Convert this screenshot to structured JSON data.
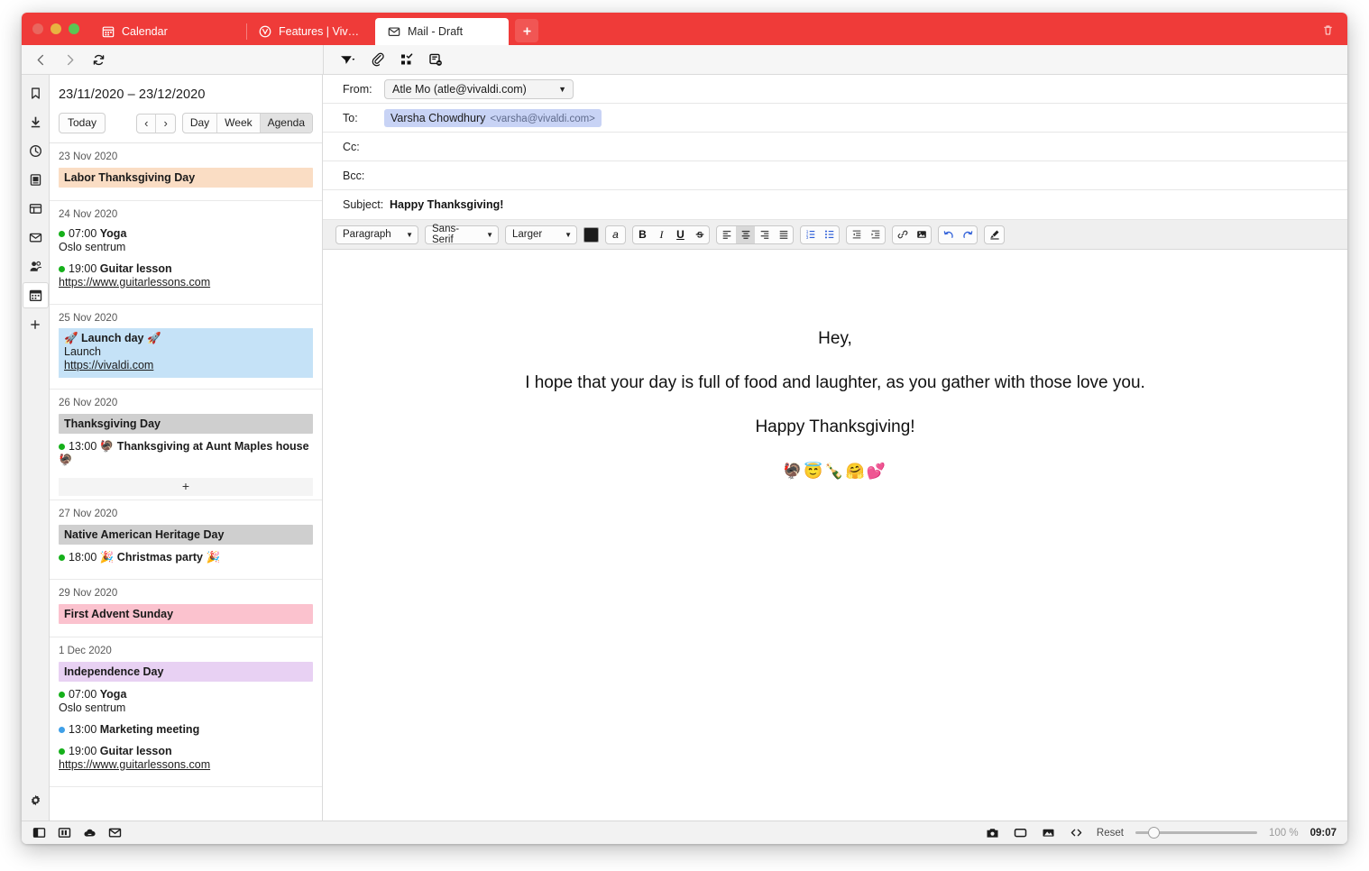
{
  "window": {
    "traffic_lights": [
      "close",
      "minimize",
      "maximize"
    ],
    "accent_color": "#EF3B39"
  },
  "tabbar": {
    "tabs": [
      {
        "label": "Calendar",
        "icon": "calendar-icon",
        "active": false
      },
      {
        "label": "Features | Vivaldi Browser",
        "icon": "vivaldi-shield-icon",
        "active": false
      },
      {
        "label": "Mail - Draft",
        "icon": "mail-icon",
        "active": true
      }
    ],
    "new_tab_label": "+",
    "trash_icon": "trash-icon"
  },
  "navbar": {
    "back_icon": "chevron-left-icon",
    "forward_icon": "chevron-right-icon",
    "reload_icon": "reload-icon",
    "mail_actions": [
      {
        "name": "send-button",
        "icon": "send-icon"
      },
      {
        "name": "attach-button",
        "icon": "paperclip-icon"
      },
      {
        "name": "spellcheck-button",
        "icon": "checkbox-grid-icon"
      },
      {
        "name": "discard-draft-button",
        "icon": "note-minus-icon"
      }
    ]
  },
  "panelstrip": {
    "items": [
      {
        "name": "panel-bookmarks",
        "icon": "bookmark-icon",
        "active": false
      },
      {
        "name": "panel-downloads",
        "icon": "download-icon",
        "active": false
      },
      {
        "name": "panel-history",
        "icon": "clock-icon",
        "active": false
      },
      {
        "name": "panel-notes",
        "icon": "notes-icon",
        "active": false
      },
      {
        "name": "panel-window",
        "icon": "window-icon",
        "active": false
      },
      {
        "name": "panel-mail",
        "icon": "envelope-icon",
        "active": false
      },
      {
        "name": "panel-contacts",
        "icon": "contacts-icon",
        "active": false
      },
      {
        "name": "panel-calendar",
        "icon": "calendar-icon",
        "active": true
      },
      {
        "name": "panel-add",
        "icon": "plus-icon",
        "active": false
      }
    ],
    "settings": {
      "name": "panel-settings",
      "icon": "gear-icon"
    }
  },
  "agenda": {
    "date_range": "23/11/2020 – 23/12/2020",
    "today_label": "Today",
    "prev_label": "‹",
    "next_label": "›",
    "views": [
      {
        "label": "Day",
        "active": false
      },
      {
        "label": "Week",
        "active": false
      },
      {
        "label": "Agenda",
        "active": true
      }
    ],
    "days": [
      {
        "date": "23 Nov 2020",
        "chips": [
          {
            "label": "Labor Thanksgiving Day",
            "color": "#FADDC4"
          }
        ],
        "events": [],
        "add_row": false
      },
      {
        "date": "24 Nov 2020",
        "chips": [],
        "events": [
          {
            "dot": "#15B01A",
            "time": "07:00",
            "title": "Yoga",
            "sub": "Oslo sentrum",
            "link": ""
          },
          {
            "dot": "#15B01A",
            "time": "19:00",
            "title": "Guitar lesson",
            "sub": "",
            "link": "https://www.guitarlessons.com"
          }
        ],
        "add_row": false
      },
      {
        "date": "25 Nov 2020",
        "chips": [],
        "events": [
          {
            "dot": "",
            "time": "",
            "title": "🚀 Launch day 🚀",
            "sub": "Launch",
            "link": "https://vivaldi.com",
            "highlight": "#C5E2F7"
          }
        ],
        "add_row": false
      },
      {
        "date": "26 Nov 2020",
        "chips": [
          {
            "label": "Thanksgiving Day",
            "color": "#CFCFCF"
          }
        ],
        "events": [
          {
            "dot": "#15B01A",
            "time": "13:00",
            "title": "🦃 Thanksgiving at Aunt Maples house 🦃",
            "sub": "",
            "link": ""
          }
        ],
        "add_row": true,
        "add_label": "+"
      },
      {
        "date": "27 Nov 2020",
        "chips": [
          {
            "label": "Native American Heritage Day",
            "color": "#CFCFCF"
          }
        ],
        "events": [
          {
            "dot": "#15B01A",
            "time": "18:00",
            "title": "🎉 Christmas party 🎉",
            "sub": "",
            "link": ""
          }
        ],
        "add_row": false
      },
      {
        "date": "29 Nov 2020",
        "chips": [
          {
            "label": "First Advent Sunday",
            "color": "#FBC2CE"
          }
        ],
        "events": [],
        "add_row": false
      },
      {
        "date": "1 Dec 2020",
        "chips": [
          {
            "label": "Independence Day",
            "color": "#E8D1F3"
          }
        ],
        "events": [
          {
            "dot": "#15B01A",
            "time": "07:00",
            "title": "Yoga",
            "sub": "Oslo sentrum",
            "link": ""
          },
          {
            "dot": "#3FA0E8",
            "time": "13:00",
            "title": "Marketing meeting",
            "sub": "",
            "link": ""
          },
          {
            "dot": "#15B01A",
            "time": "19:00",
            "title": "Guitar lesson",
            "sub": "",
            "link": "https://www.guitarlessons.com"
          }
        ],
        "add_row": false
      }
    ]
  },
  "compose": {
    "from_label": "From:",
    "from_value": "Atle Mo (atle@vivaldi.com)",
    "to_label": "To:",
    "to_name": "Varsha Chowdhury",
    "to_address": "<varsha@vivaldi.com>",
    "cc_label": "Cc:",
    "cc_value": "",
    "bcc_label": "Bcc:",
    "bcc_value": "",
    "subject_label": "Subject:",
    "subject_value": "Happy Thanksgiving!",
    "toolbar": {
      "block_format": "Paragraph",
      "font_family": "Sans-Serif",
      "font_size": "Larger",
      "text_color": "#1b1b1b",
      "highlight_label": "a",
      "buttons": [
        {
          "name": "bold-button",
          "glyph": "B",
          "active": false
        },
        {
          "name": "italic-button",
          "glyph": "I",
          "active": false
        },
        {
          "name": "underline-button",
          "glyph": "U",
          "active": false
        },
        {
          "name": "strikethrough-button",
          "glyph": "S",
          "active": false
        },
        {
          "name": "align-left-button",
          "glyph": "align-left-icon",
          "active": false
        },
        {
          "name": "align-center-button",
          "glyph": "align-center-icon",
          "active": true
        },
        {
          "name": "align-right-button",
          "glyph": "align-right-icon",
          "active": false
        },
        {
          "name": "align-justify-button",
          "glyph": "align-justify-icon",
          "active": false
        },
        {
          "name": "ordered-list-button",
          "glyph": "ordered-list-icon",
          "active": false
        },
        {
          "name": "unordered-list-button",
          "glyph": "unordered-list-icon",
          "active": false
        },
        {
          "name": "outdent-button",
          "glyph": "outdent-icon",
          "active": false
        },
        {
          "name": "indent-button",
          "glyph": "indent-icon",
          "active": false
        },
        {
          "name": "link-button",
          "glyph": "link-icon",
          "active": false
        },
        {
          "name": "image-button",
          "glyph": "image-icon",
          "active": false
        },
        {
          "name": "undo-button",
          "glyph": "undo-icon",
          "active": false
        },
        {
          "name": "redo-button",
          "glyph": "redo-icon",
          "active": false
        },
        {
          "name": "clear-format-button",
          "glyph": "brush-icon",
          "active": false
        }
      ]
    },
    "body": {
      "line1": "Hey,",
      "line2": "I hope that your day is full of food and laughter, as you gather with those love you.",
      "line3": "Happy Thanksgiving!",
      "emoji": "🦃😇🍾🤗💕"
    }
  },
  "statusbar": {
    "left_icons": [
      {
        "name": "toggle-panel-button",
        "icon": "panel-toggle-icon"
      },
      {
        "name": "tile-tabs-button",
        "icon": "tile-icon"
      },
      {
        "name": "sync-button",
        "icon": "cloud-icon"
      },
      {
        "name": "mail-status-button",
        "icon": "envelope-icon"
      }
    ],
    "right_icons": [
      {
        "name": "capture-page-button",
        "icon": "camera-icon"
      },
      {
        "name": "tiling-button",
        "icon": "rectangle-icon"
      },
      {
        "name": "images-toggle-button",
        "icon": "image-icon"
      },
      {
        "name": "developer-tools-button",
        "icon": "code-icon"
      }
    ],
    "reset_label": "Reset",
    "zoom_value": "100 %",
    "clock": "09:07"
  }
}
